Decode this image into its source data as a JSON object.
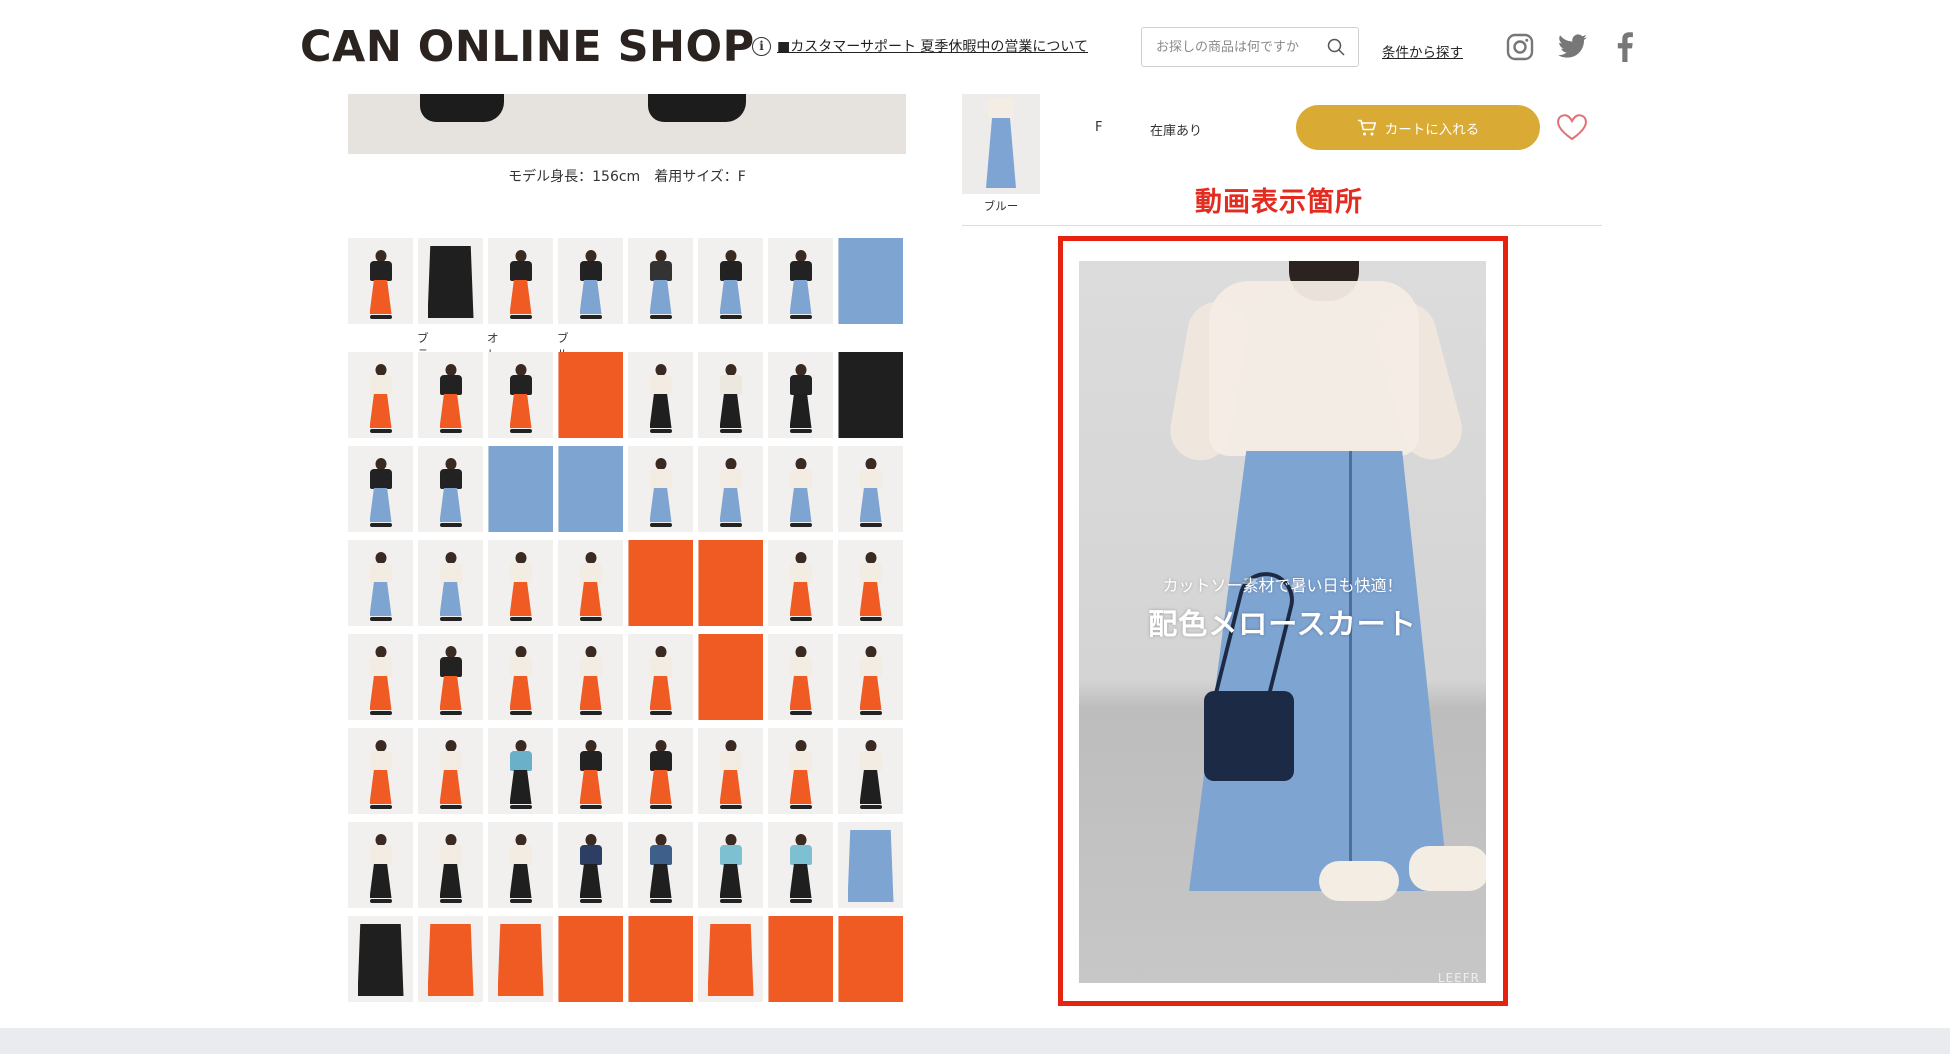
{
  "header": {
    "logo": "CAN ONLINE SHOP",
    "notice_link": "■カスタマーサポート 夏季休暇中の営業について",
    "info_icon_text": "i",
    "search_placeholder": "お探しの商品は何ですか",
    "condition_search_link": "条件から探す",
    "social": [
      "instagram-icon",
      "twitter-icon",
      "facebook-icon"
    ]
  },
  "left": {
    "model_caption": "モデル身長：156cm　着用サイズ：F",
    "color_labels": [
      "ブラック",
      "オレンジ",
      "ブルー"
    ]
  },
  "product_row": {
    "color": "ブルー",
    "size": "F",
    "stock": "在庫あり",
    "cart_button": "カートに入れる"
  },
  "annotation": {
    "video_label": "動画表示箇所"
  },
  "video": {
    "caption_sub": "カットソー素材で暑い日も快適！",
    "caption_main": "配色メロースカート",
    "watermark": "LEEFR"
  },
  "colors": {
    "orange": "#f05a23",
    "black": "#1f1f1f",
    "blue": "#7ea4d2",
    "cart": "#d9ab34",
    "frame": "#e5230f"
  }
}
